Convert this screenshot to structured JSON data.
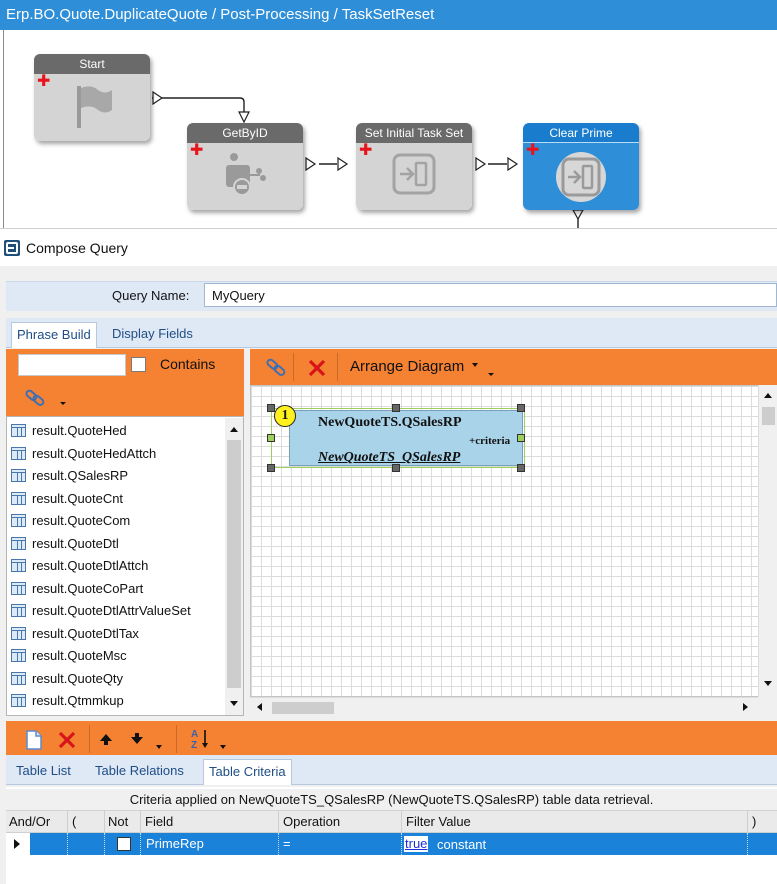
{
  "workflow": {
    "title": "Erp.BO.Quote.DuplicateQuote / Post-Processing / TaskSetReset",
    "activities": [
      {
        "label": "Start"
      },
      {
        "label": "GetByID"
      },
      {
        "label": "Set Initial Task Set"
      },
      {
        "label": "Clear Prime"
      }
    ]
  },
  "compose": {
    "window_title": "Compose Query",
    "query_name_label": "Query Name:",
    "query_name_value": "MyQuery",
    "top_tabs": [
      {
        "label": "Phrase Build",
        "active": true
      },
      {
        "label": "Display Fields",
        "active": false
      }
    ],
    "left": {
      "search_value": "",
      "contains_label": "Contains",
      "contains_checked": false,
      "tables": [
        "result.QuoteHed",
        "result.QuoteHedAttch",
        "result.QSalesRP",
        "result.QuoteCnt",
        "result.QuoteCom",
        "result.QuoteDtl",
        "result.QuoteDtlAttch",
        "result.QuoteCoPart",
        "result.QuoteDtlAttrValueSet",
        "result.QuoteDtlTax",
        "result.QuoteMsc",
        "result.QuoteQty",
        "result.Qtmmkup"
      ]
    },
    "diagram": {
      "arrange_label": "Arrange Diagram",
      "node": {
        "number": "1",
        "table": "NewQuoteTS.QSalesRP",
        "criteria": "+criteria",
        "alias": "NewQuoteTS_QSalesRP"
      }
    },
    "bottom_tabs": [
      {
        "label": "Table List",
        "active": false
      },
      {
        "label": "Table Relations",
        "active": false
      },
      {
        "label": "Table Criteria",
        "active": true
      }
    ],
    "criteria": {
      "message": "Criteria applied on NewQuoteTS_QSalesRP (NewQuoteTS.QSalesRP)  table data retrieval.",
      "columns": [
        "And/Or",
        "(",
        "Not",
        "Field",
        "Operation",
        "Filter Value",
        ")"
      ],
      "row": {
        "field": "PrimeRep",
        "operation": "=",
        "value_link": "true",
        "value_type": "constant"
      }
    },
    "colors": {
      "accent_orange": "#f58132",
      "selection_blue": "#1a82d9",
      "title_blue": "#2e8ed8"
    }
  }
}
